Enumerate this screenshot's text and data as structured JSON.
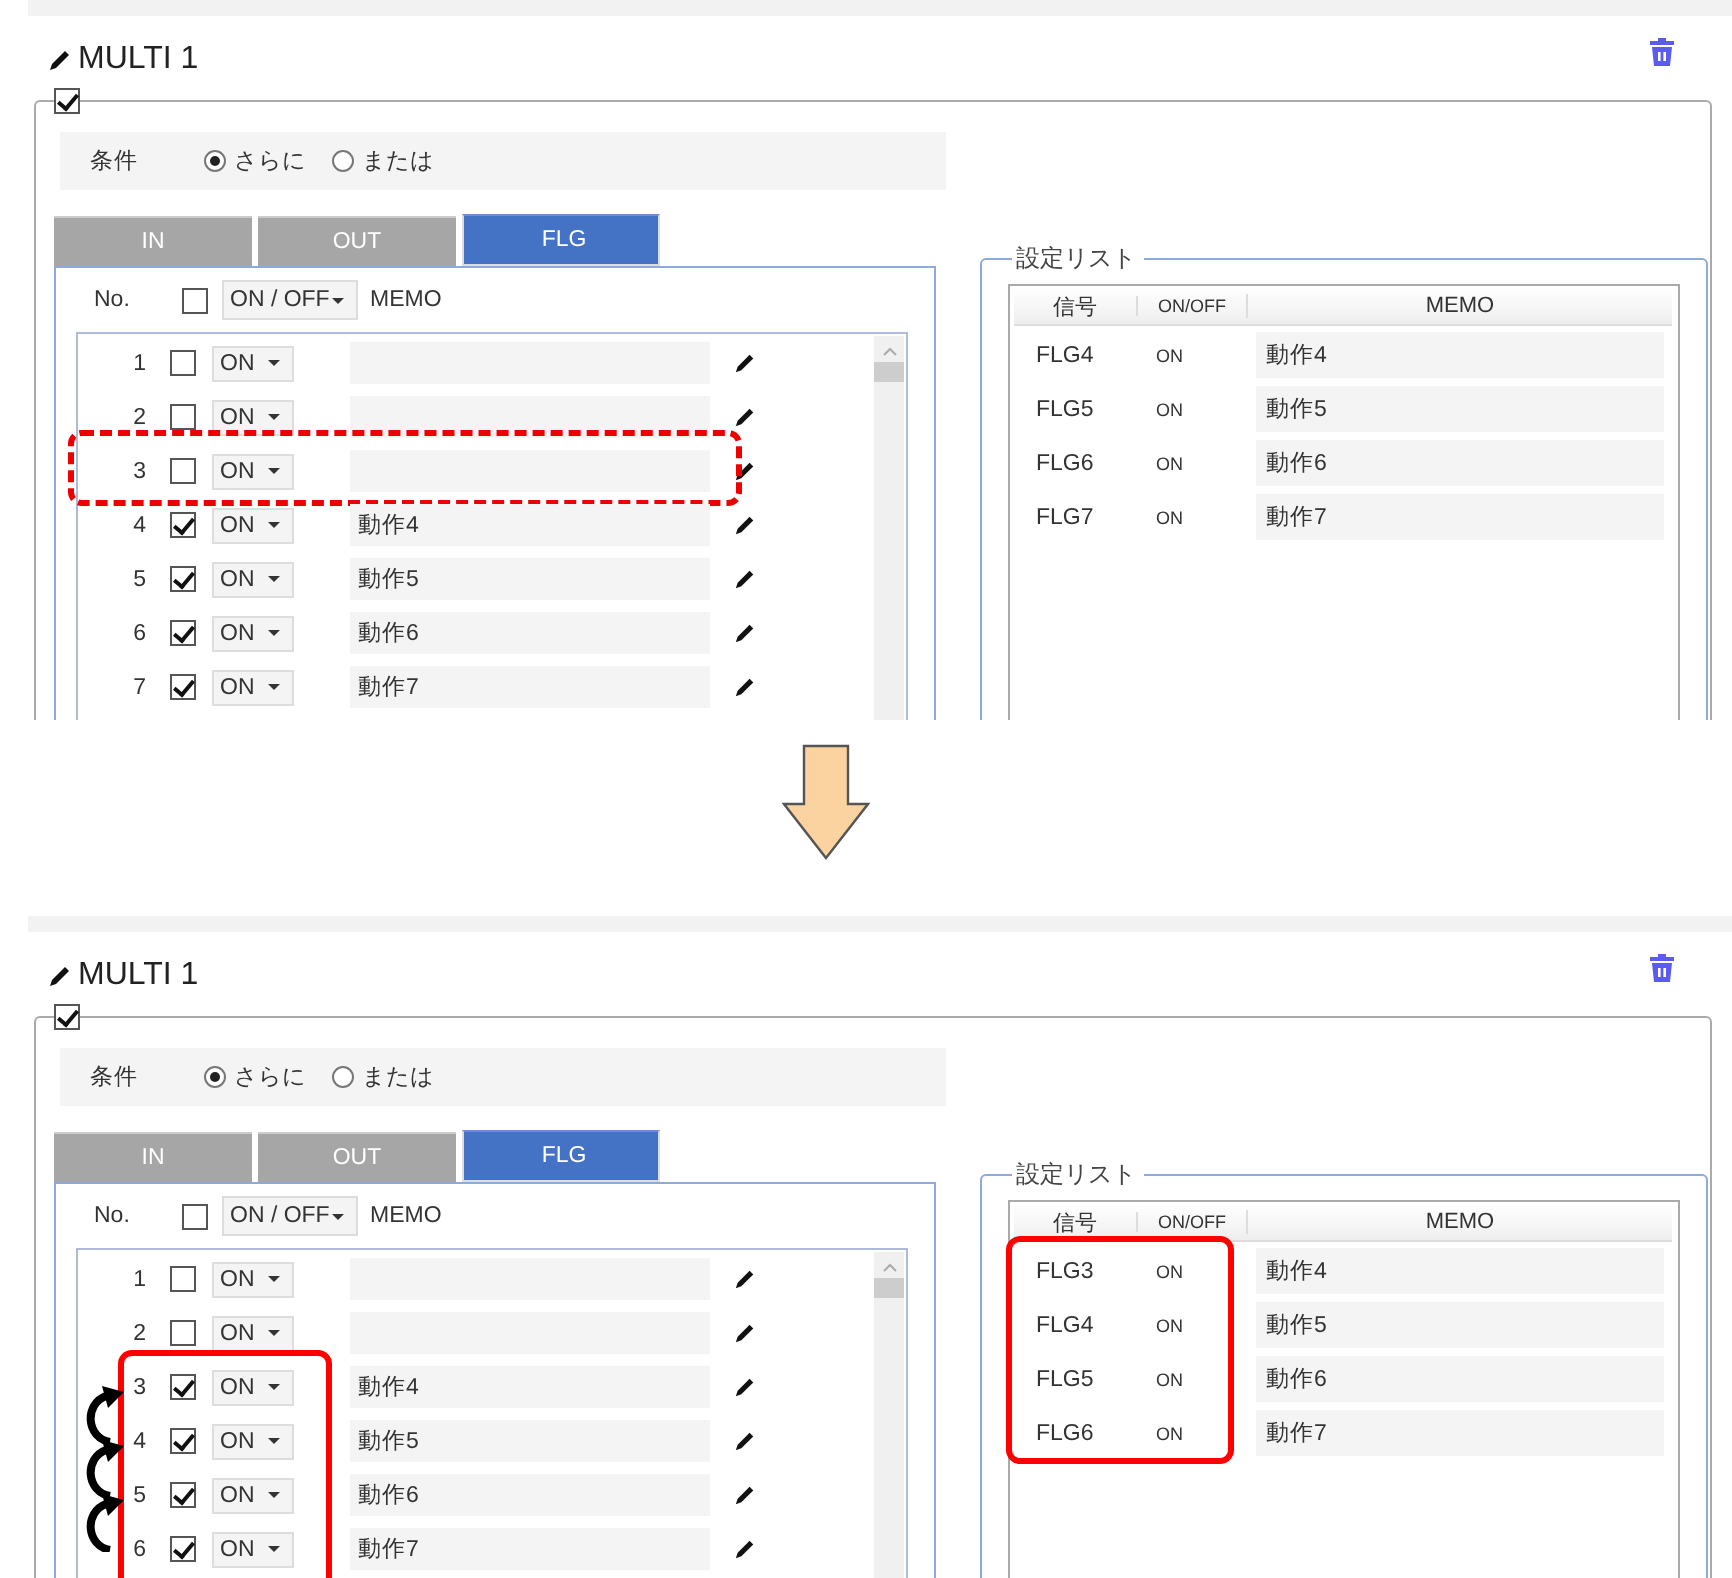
{
  "panels": [
    {
      "title": "MULTI 1",
      "enabled": true,
      "highlight": {
        "kind": "dashed"
      },
      "shift_arrows": false,
      "condition": {
        "label": "条件",
        "options": [
          {
            "label": "さらに",
            "selected": true
          },
          {
            "label": "または",
            "selected": false
          }
        ]
      },
      "tabs": [
        {
          "label": "IN",
          "selected": false
        },
        {
          "label": "OUT",
          "selected": false
        },
        {
          "label": "FLG",
          "selected": true
        }
      ],
      "grid": {
        "no_header": "No.",
        "all_checked": false,
        "onoff_header": "ON / OFF",
        "memo_header": "MEMO",
        "rows": [
          {
            "no": "1",
            "checked": false,
            "value": "ON",
            "memo": "",
            "highlighted": false
          },
          {
            "no": "2",
            "checked": false,
            "value": "ON",
            "memo": "",
            "highlighted": false
          },
          {
            "no": "3",
            "checked": false,
            "value": "ON",
            "memo": "",
            "highlighted": true
          },
          {
            "no": "4",
            "checked": true,
            "value": "ON",
            "memo": "動作4",
            "highlighted": false
          },
          {
            "no": "5",
            "checked": true,
            "value": "ON",
            "memo": "動作5",
            "highlighted": false
          },
          {
            "no": "6",
            "checked": true,
            "value": "ON",
            "memo": "動作6",
            "highlighted": false
          },
          {
            "no": "7",
            "checked": true,
            "value": "ON",
            "memo": "動作7",
            "highlighted": false
          }
        ]
      },
      "settings": {
        "legend": "設定リスト",
        "columns": [
          "信号",
          "ON/OFF",
          "MEMO"
        ],
        "rows": [
          {
            "signal": "FLG4",
            "onoff": "ON",
            "memo": "動作4",
            "highlighted": false
          },
          {
            "signal": "FLG5",
            "onoff": "ON",
            "memo": "動作5",
            "highlighted": false
          },
          {
            "signal": "FLG6",
            "onoff": "ON",
            "memo": "動作6",
            "highlighted": false
          },
          {
            "signal": "FLG7",
            "onoff": "ON",
            "memo": "動作7",
            "highlighted": false
          }
        ]
      }
    },
    {
      "title": "MULTI 1",
      "enabled": true,
      "highlight": {
        "kind": "solid"
      },
      "shift_arrows": true,
      "condition": {
        "label": "条件",
        "options": [
          {
            "label": "さらに",
            "selected": true
          },
          {
            "label": "または",
            "selected": false
          }
        ]
      },
      "tabs": [
        {
          "label": "IN",
          "selected": false
        },
        {
          "label": "OUT",
          "selected": false
        },
        {
          "label": "FLG",
          "selected": true
        }
      ],
      "grid": {
        "no_header": "No.",
        "all_checked": false,
        "onoff_header": "ON / OFF",
        "memo_header": "MEMO",
        "rows": [
          {
            "no": "1",
            "checked": false,
            "value": "ON",
            "memo": "",
            "highlighted": false
          },
          {
            "no": "2",
            "checked": false,
            "value": "ON",
            "memo": "",
            "highlighted": false
          },
          {
            "no": "3",
            "checked": true,
            "value": "ON",
            "memo": "動作4",
            "highlighted": true
          },
          {
            "no": "4",
            "checked": true,
            "value": "ON",
            "memo": "動作5",
            "highlighted": true
          },
          {
            "no": "5",
            "checked": true,
            "value": "ON",
            "memo": "動作6",
            "highlighted": true
          },
          {
            "no": "6",
            "checked": true,
            "value": "ON",
            "memo": "動作7",
            "highlighted": true
          }
        ]
      },
      "settings": {
        "legend": "設定リスト",
        "columns": [
          "信号",
          "ON/OFF",
          "MEMO"
        ],
        "rows": [
          {
            "signal": "FLG3",
            "onoff": "ON",
            "memo": "動作4",
            "highlighted": true
          },
          {
            "signal": "FLG4",
            "onoff": "ON",
            "memo": "動作5",
            "highlighted": true
          },
          {
            "signal": "FLG5",
            "onoff": "ON",
            "memo": "動作6",
            "highlighted": true
          },
          {
            "signal": "FLG6",
            "onoff": "ON",
            "memo": "動作7",
            "highlighted": true
          }
        ]
      }
    }
  ]
}
